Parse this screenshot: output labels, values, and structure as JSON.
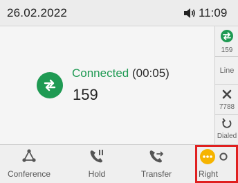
{
  "status_bar": {
    "date": "26.02.2022",
    "time": "11:09"
  },
  "call": {
    "status": "Connected",
    "duration": "(00:05)",
    "number": "159"
  },
  "side_keys": [
    {
      "label": "159",
      "icon": "call-transfer-icon"
    },
    {
      "label": "Line",
      "icon": ""
    },
    {
      "label": "7788",
      "icon": "missed-call-x-icon"
    },
    {
      "label": "Dialed",
      "icon": "redial-icon"
    }
  ],
  "softkeys": [
    {
      "label": "Conference",
      "icon": "conference-icon"
    },
    {
      "label": "Hold",
      "icon": "hold-icon"
    },
    {
      "label": "Transfer",
      "icon": "transfer-icon"
    },
    {
      "label": "Right",
      "icon": "more-dots-icon"
    }
  ],
  "colors": {
    "connected": "#1f9a53",
    "more_button": "#f6b400",
    "highlight": "#e02020"
  }
}
